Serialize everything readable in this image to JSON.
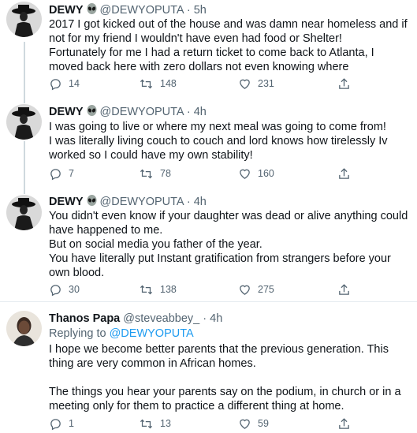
{
  "tweets": [
    {
      "name": "DEWY",
      "handle": "@DEWYOPUTA",
      "time": "5h",
      "text": "2017 I got kicked out of the house and was damn near homeless and if not for my friend I wouldn't  have even had food or Shelter!\nFortunately for me I had a return ticket to come back to Atlanta, I moved back here with zero dollars not even knowing where",
      "replies": "14",
      "retweets": "148",
      "likes": "231"
    },
    {
      "name": "DEWY",
      "handle": "@DEWYOPUTA",
      "time": "4h",
      "text": "I was going to live or where my next meal was going to come from!\nI was literally living couch to couch and lord knows how tirelessly Iv worked so I could have my own stability!",
      "replies": "7",
      "retweets": "78",
      "likes": "160"
    },
    {
      "name": "DEWY",
      "handle": "@DEWYOPUTA",
      "time": "4h",
      "text": "You didn't even know if your daughter was dead or alive anything could have happened to me.\nBut on social media you father of the year.\nYou have literally put Instant gratification from strangers before your own blood.",
      "replies": "30",
      "retweets": "138",
      "likes": "275"
    },
    {
      "name": "Thanos Papa",
      "handle": "@steveabbey_",
      "time": "4h",
      "replying_label": "Replying to",
      "replying_to": "@DEWYOPUTA",
      "text": "I hope we become better parents that the previous generation. This thing are very common in African homes.\n\nThe things you hear your parents say on the podium, in church or in a meeting only for them to practice a different thing at home.",
      "replies": "1",
      "retweets": "13",
      "likes": "59"
    }
  ],
  "separator": " · ",
  "icons": [
    "alien-emoji-icon",
    "reply-icon",
    "retweet-icon",
    "like-icon",
    "share-icon"
  ],
  "colors": {
    "muted": "#536471",
    "link": "#1d9bf0",
    "divider": "#e6ecf0"
  }
}
